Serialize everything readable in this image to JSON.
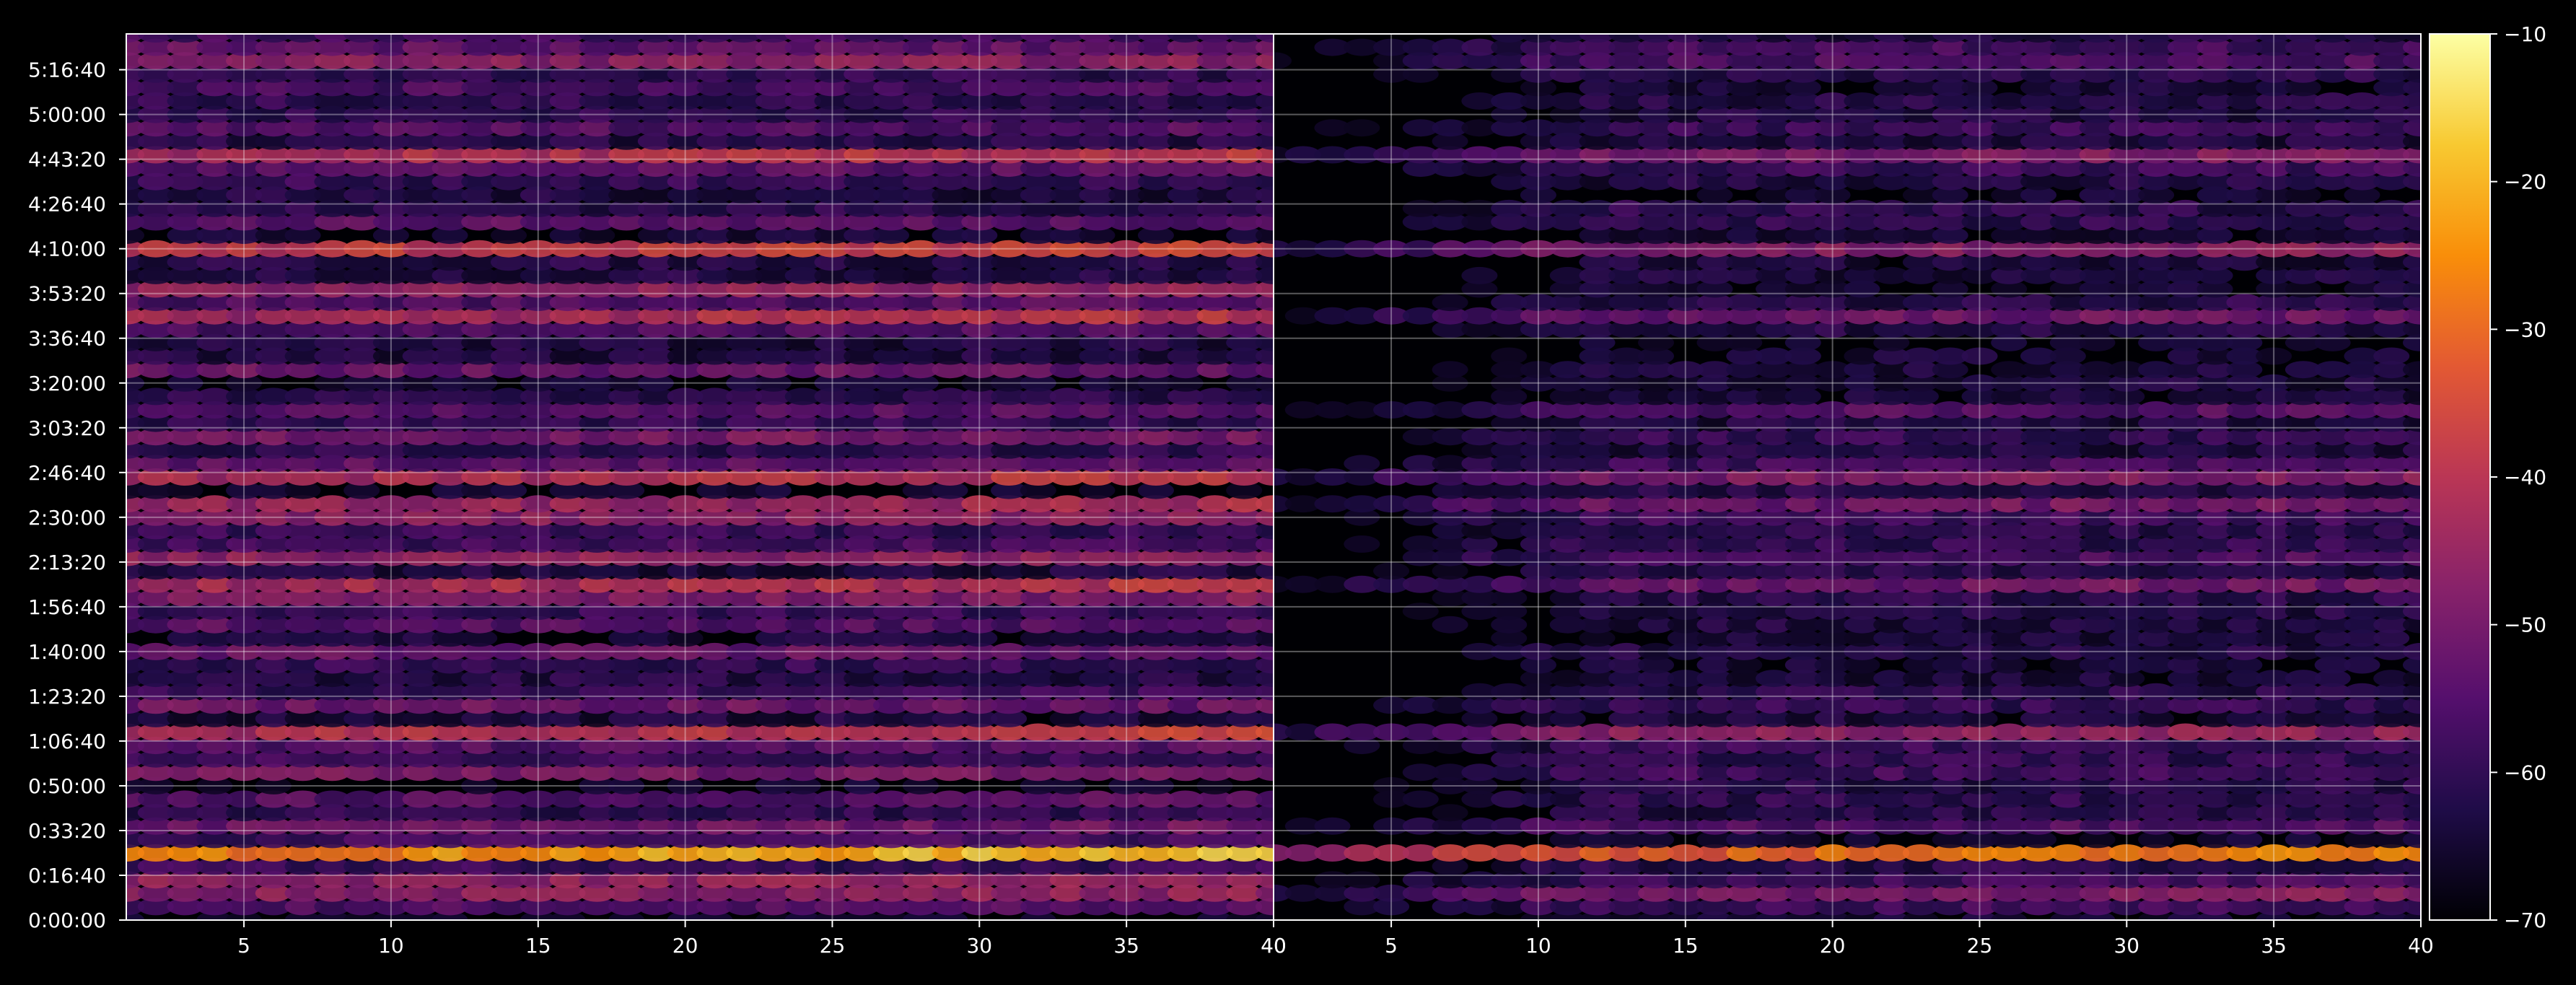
{
  "chart_data": [
    {
      "type": "heatmap",
      "panel": "left",
      "colormap": "inferno",
      "x": {
        "ticks": [
          5,
          10,
          15,
          20,
          25,
          30,
          35,
          40
        ],
        "range": [
          1,
          40
        ]
      },
      "y": {
        "ticks": [
          "0:00:00",
          "0:16:40",
          "0:33:20",
          "0:50:00",
          "1:06:40",
          "1:23:20",
          "1:40:00",
          "1:56:40",
          "2:13:20",
          "2:30:00",
          "2:46:40",
          "3:03:20",
          "3:20:00",
          "3:36:40",
          "3:53:20",
          "4:10:00",
          "4:26:40",
          "4:43:20",
          "5:00:00",
          "5:16:40"
        ],
        "range_seconds": [
          0,
          19800
        ]
      },
      "bands": [
        {
          "t": 500,
          "level": -34,
          "ramp": 2
        },
        {
          "t": 1000,
          "level": -36,
          "ramp": 1
        },
        {
          "t": 1500,
          "level": -22,
          "ramp": 6
        },
        {
          "t": 2000,
          "level": -44,
          "ramp": 1
        },
        {
          "t": 2600,
          "level": -50,
          "ramp": 1
        },
        {
          "t": 3400,
          "level": -42,
          "ramp": 0
        },
        {
          "t": 4100,
          "level": -25,
          "ramp": 4
        },
        {
          "t": 4900,
          "level": -44,
          "ramp": 0
        },
        {
          "t": 5900,
          "level": -46,
          "ramp": 0
        },
        {
          "t": 6700,
          "level": -50,
          "ramp": -1
        },
        {
          "t": 7300,
          "level": -47,
          "ramp": 0
        },
        {
          "t": 7400,
          "level": -30,
          "ramp": 4
        },
        {
          "t": 8200,
          "level": -35,
          "ramp": 1
        },
        {
          "t": 8900,
          "level": -44,
          "ramp": 0
        },
        {
          "t": 9200,
          "level": -32,
          "ramp": 3
        },
        {
          "t": 10000,
          "level": -26,
          "ramp": 4
        },
        {
          "t": 10700,
          "level": -42,
          "ramp": 1
        },
        {
          "t": 11300,
          "level": -48,
          "ramp": 0
        },
        {
          "t": 12300,
          "level": -52,
          "ramp": -1
        },
        {
          "t": 13100,
          "level": -50,
          "ramp": 0
        },
        {
          "t": 13600,
          "level": -28,
          "ramp": 4
        },
        {
          "t": 14100,
          "level": -46,
          "ramp": 0
        },
        {
          "t": 15000,
          "level": -38,
          "ramp": 1
        },
        {
          "t": 15700,
          "level": -46,
          "ramp": 0
        },
        {
          "t": 16400,
          "level": -56,
          "ramp": -1
        },
        {
          "t": 17000,
          "level": -28,
          "ramp": 3
        },
        {
          "t": 17800,
          "level": -47,
          "ramp": 0
        },
        {
          "t": 18500,
          "level": -50,
          "ramp": 0
        },
        {
          "t": 19100,
          "level": -38,
          "ramp": 0
        },
        {
          "t": 19600,
          "level": -44,
          "ramp": -1
        }
      ]
    },
    {
      "type": "heatmap",
      "panel": "right",
      "colormap": "inferno",
      "x": {
        "ticks": [
          40,
          5,
          10,
          15,
          20,
          25,
          30,
          35,
          40
        ],
        "range": [
          1,
          40
        ]
      },
      "bands": [
        {
          "t": 500,
          "level": -40,
          "ramp": 2
        },
        {
          "t": 1000,
          "level": -55,
          "ramp": 1
        },
        {
          "t": 1500,
          "level": -30,
          "ramp": 4
        },
        {
          "t": 2100,
          "level": -55,
          "ramp": 1
        },
        {
          "t": 2700,
          "level": -60,
          "ramp": 0
        },
        {
          "t": 3400,
          "level": -52,
          "ramp": 2
        },
        {
          "t": 4100,
          "level": -36,
          "ramp": 3
        },
        {
          "t": 4900,
          "level": -55,
          "ramp": 0
        },
        {
          "t": 6100,
          "level": -60,
          "ramp": 0
        },
        {
          "t": 6900,
          "level": -62,
          "ramp": 0
        },
        {
          "t": 7400,
          "level": -44,
          "ramp": 3
        },
        {
          "t": 8000,
          "level": -50,
          "ramp": 1
        },
        {
          "t": 8400,
          "level": -60,
          "ramp": 0
        },
        {
          "t": 9200,
          "level": -42,
          "ramp": 3
        },
        {
          "t": 10000,
          "level": -40,
          "ramp": 3
        },
        {
          "t": 10700,
          "level": -55,
          "ramp": 0
        },
        {
          "t": 11300,
          "level": -50,
          "ramp": 1
        },
        {
          "t": 13600,
          "level": -44,
          "ramp": 3
        },
        {
          "t": 15000,
          "level": -48,
          "ramp": 1
        },
        {
          "t": 15700,
          "level": -58,
          "ramp": 0
        },
        {
          "t": 17000,
          "level": -40,
          "ramp": 3
        },
        {
          "t": 17800,
          "level": -55,
          "ramp": 0
        },
        {
          "t": 19100,
          "level": -50,
          "ramp": 0
        },
        {
          "t": 19600,
          "level": -55,
          "ramp": 0
        }
      ]
    }
  ],
  "colorbar": {
    "min": -70,
    "max": -10,
    "tick_labels": [
      "−10",
      "−20",
      "−30",
      "−40",
      "−50",
      "−60",
      "−70"
    ]
  }
}
